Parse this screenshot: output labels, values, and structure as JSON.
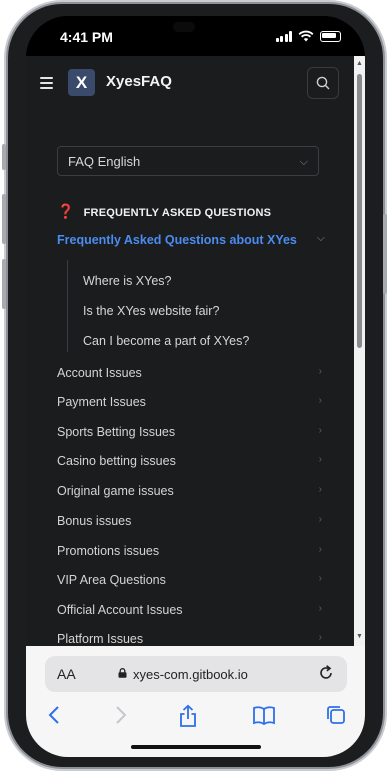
{
  "status": {
    "time": "4:41 PM"
  },
  "header": {
    "logo_letter": "X",
    "title": "XyesFAQ"
  },
  "language_select": {
    "value": "FAQ English"
  },
  "section": {
    "title": "FREQUENTLY ASKED QUESTIONS",
    "icon": "question-mark-icon"
  },
  "active_group": {
    "label": "Frequently Asked Questions about XYes",
    "children": [
      "Where is XYes?",
      "Is the XYes website fair?",
      "Can I become a part of XYes?"
    ]
  },
  "nav_items": [
    "Account Issues",
    "Payment Issues",
    "Sports Betting Issues",
    "Casino betting issues",
    "Original game issues",
    "Bonus issues",
    "Promotions issues",
    "VIP Area Questions",
    "Official Account Issues",
    "Platform Issues"
  ],
  "browser": {
    "aa_label": "AA",
    "url": "xyes-com.gitbook.io"
  },
  "colors": {
    "accent": "#4a8cf0",
    "background": "#1b1c1e",
    "question_icon": "#e23b2e"
  }
}
